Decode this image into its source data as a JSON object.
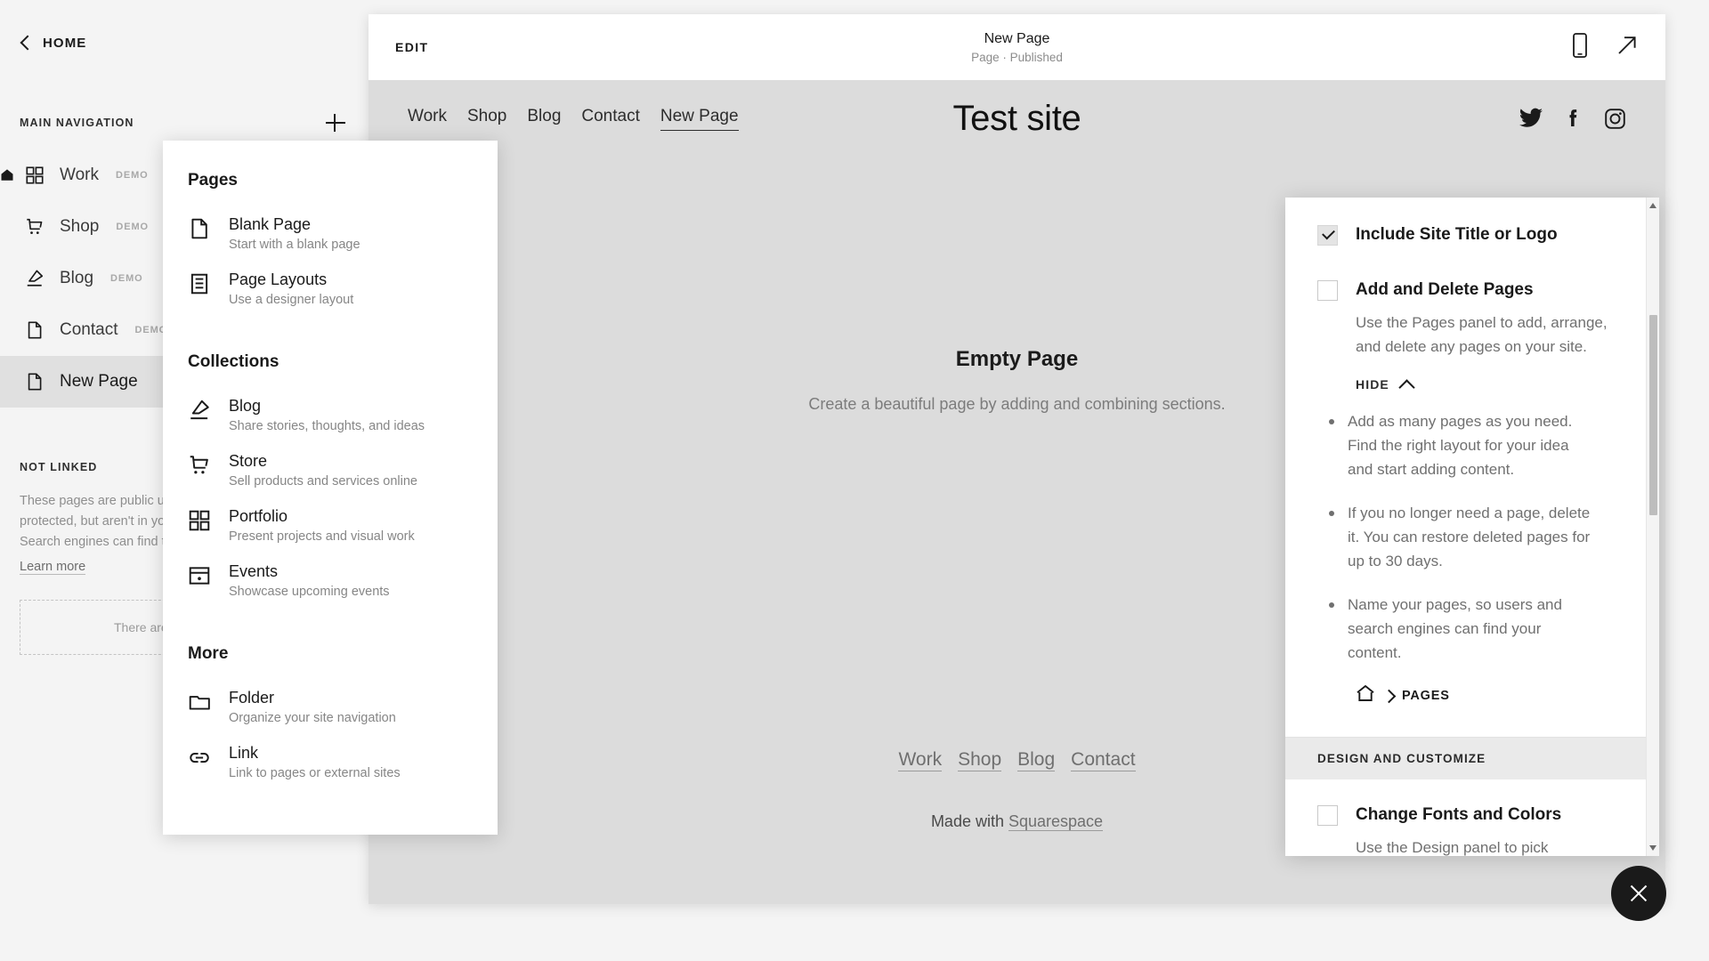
{
  "sidebar": {
    "back_label": "HOME",
    "section_title": "MAIN NAVIGATION",
    "add_button_icon": "plus-icon",
    "items": [
      {
        "label": "Work",
        "badge": "DEMO",
        "icon": "grid-icon",
        "active": false,
        "home": true
      },
      {
        "label": "Shop",
        "badge": "DEMO",
        "icon": "cart-icon",
        "active": false,
        "home": false
      },
      {
        "label": "Blog",
        "badge": "DEMO",
        "icon": "pen-icon",
        "active": false,
        "home": false
      },
      {
        "label": "Contact",
        "badge": "DEMO",
        "icon": "page-icon",
        "active": false,
        "home": false
      },
      {
        "label": "New Page",
        "badge": "",
        "icon": "page-icon",
        "active": true,
        "home": false
      }
    ],
    "not_linked_title": "NOT LINKED",
    "not_linked_body": "These pages are public unless password-protected, but aren't in your site navigation. Search engines can find them.",
    "learn_more": "Learn more",
    "empty_drop_text": "There are no pages here."
  },
  "editor": {
    "edit_label": "EDIT",
    "page_title": "New Page",
    "page_status": "Page · Published",
    "mobile_icon": "mobile-device-icon",
    "open_icon": "open-external-icon"
  },
  "site": {
    "title": "Test site",
    "nav": [
      {
        "label": "Work",
        "current": false
      },
      {
        "label": "Shop",
        "current": false
      },
      {
        "label": "Blog",
        "current": false
      },
      {
        "label": "Contact",
        "current": false
      },
      {
        "label": "New Page",
        "current": true
      }
    ],
    "socials": [
      "twitter-icon",
      "facebook-icon",
      "instagram-icon"
    ],
    "empty_title": "Empty Page",
    "empty_sub": "Create a beautiful page by adding and combining sections.",
    "footer_nav": [
      "Work",
      "Shop",
      "Blog",
      "Contact"
    ],
    "made_with_prefix": "Made with ",
    "made_with_brand": "Squarespace"
  },
  "dropdown": {
    "groups": [
      {
        "title": "Pages",
        "items": [
          {
            "title": "Blank Page",
            "desc": "Start with a blank page",
            "icon": "page-icon"
          },
          {
            "title": "Page Layouts",
            "desc": "Use a designer layout",
            "icon": "layout-icon"
          }
        ]
      },
      {
        "title": "Collections",
        "items": [
          {
            "title": "Blog",
            "desc": "Share stories, thoughts, and ideas",
            "icon": "pen-icon"
          },
          {
            "title": "Store",
            "desc": "Sell products and services online",
            "icon": "cart-icon"
          },
          {
            "title": "Portfolio",
            "desc": "Present projects and visual work",
            "icon": "grid-icon"
          },
          {
            "title": "Events",
            "desc": "Showcase upcoming events",
            "icon": "calendar-icon"
          }
        ]
      },
      {
        "title": "More",
        "items": [
          {
            "title": "Folder",
            "desc": "Organize your site navigation",
            "icon": "folder-icon"
          },
          {
            "title": "Link",
            "desc": "Link to pages or external sites",
            "icon": "link-icon"
          }
        ]
      }
    ]
  },
  "help_panel": {
    "item1": {
      "label": "Include Site Title or Logo",
      "checked": true
    },
    "item2": {
      "label": "Add and Delete Pages",
      "checked": false,
      "desc": "Use the Pages panel to add, arrange, and delete any pages on your site.",
      "toggle_label": "HIDE",
      "bullets": [
        "Add as many pages as you need. Find the right layout for your idea and start adding content.",
        "If you no longer need a page, delete it. You can restore deleted pages for up to 30 days.",
        "Name your pages, so users and search engines can find your content."
      ],
      "crumb_home_icon": "home-icon",
      "crumb_label": "PAGES"
    },
    "section_bar": "DESIGN AND CUSTOMIZE",
    "item3": {
      "label": "Change Fonts and Colors",
      "checked": false,
      "desc": "Use the Design panel to pick"
    }
  },
  "fab": {
    "icon": "close-icon"
  }
}
